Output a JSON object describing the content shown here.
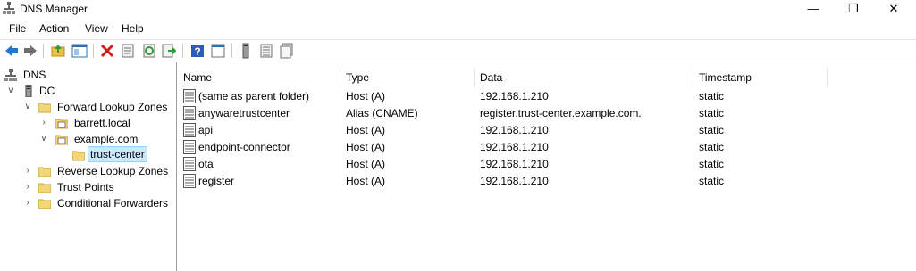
{
  "window": {
    "title": "DNS Manager",
    "minimize": "—",
    "restore": "❐",
    "close": "✕"
  },
  "menu": [
    "File",
    "Action",
    "View",
    "Help"
  ],
  "toolbar": [
    {
      "name": "back-icon",
      "color": "#1e78d2"
    },
    {
      "name": "forward-icon",
      "color": "#6e6e6e"
    },
    {
      "name": "up-folder-icon",
      "color": "#d9a830"
    },
    {
      "name": "show-hide-tree-icon",
      "color": "#2d6fb5"
    },
    {
      "name": "delete-icon",
      "color": "#d21e1e"
    },
    {
      "name": "properties-icon",
      "color": "#707070"
    },
    {
      "name": "refresh-icon",
      "color": "#2f9a3a"
    },
    {
      "name": "export-list-icon",
      "color": "#2f9a3a"
    },
    {
      "name": "help-icon",
      "color": "#2d5bb5"
    },
    {
      "name": "mmc-view-icon",
      "color": "#707070"
    },
    {
      "name": "server-icon",
      "color": "#707070"
    },
    {
      "name": "record-list-icon",
      "color": "#707070"
    },
    {
      "name": "record-pages-icon",
      "color": "#707070"
    }
  ],
  "tree": [
    {
      "label": "DNS",
      "level": 0,
      "expander": "",
      "icon": "dns-icon",
      "selected": false
    },
    {
      "label": "DC",
      "level": 1,
      "expander": "v",
      "icon": "server-icon",
      "selected": false
    },
    {
      "label": "Forward Lookup Zones",
      "level": 2,
      "expander": "v",
      "icon": "folder-icon",
      "selected": false
    },
    {
      "label": "barrett.local",
      "level": 3,
      "expander": ">",
      "icon": "zone-icon",
      "selected": false
    },
    {
      "label": "example.com",
      "level": 3,
      "expander": "v",
      "icon": "zone-icon",
      "selected": false
    },
    {
      "label": "trust-center",
      "level": 4,
      "expander": "",
      "icon": "folder-icon",
      "selected": true
    },
    {
      "label": "Reverse Lookup Zones",
      "level": 2,
      "expander": ">",
      "icon": "folder-icon",
      "selected": false
    },
    {
      "label": "Trust Points",
      "level": 2,
      "expander": ">",
      "icon": "folder-icon",
      "selected": false
    },
    {
      "label": "Conditional Forwarders",
      "level": 2,
      "expander": ">",
      "icon": "folder-icon",
      "selected": false
    }
  ],
  "columns": [
    "Name",
    "Type",
    "Data",
    "Timestamp"
  ],
  "records": [
    {
      "name": "(same as parent folder)",
      "type": "Host (A)",
      "data": "192.168.1.210",
      "timestamp": "static"
    },
    {
      "name": "anywaretrustcenter",
      "type": "Alias (CNAME)",
      "data": "register.trust-center.example.com.",
      "timestamp": "static"
    },
    {
      "name": "api",
      "type": "Host (A)",
      "data": "192.168.1.210",
      "timestamp": "static"
    },
    {
      "name": "endpoint-connector",
      "type": "Host (A)",
      "data": "192.168.1.210",
      "timestamp": "static"
    },
    {
      "name": "ota",
      "type": "Host (A)",
      "data": "192.168.1.210",
      "timestamp": "static"
    },
    {
      "name": "register",
      "type": "Host (A)",
      "data": "192.168.1.210",
      "timestamp": "static"
    }
  ]
}
